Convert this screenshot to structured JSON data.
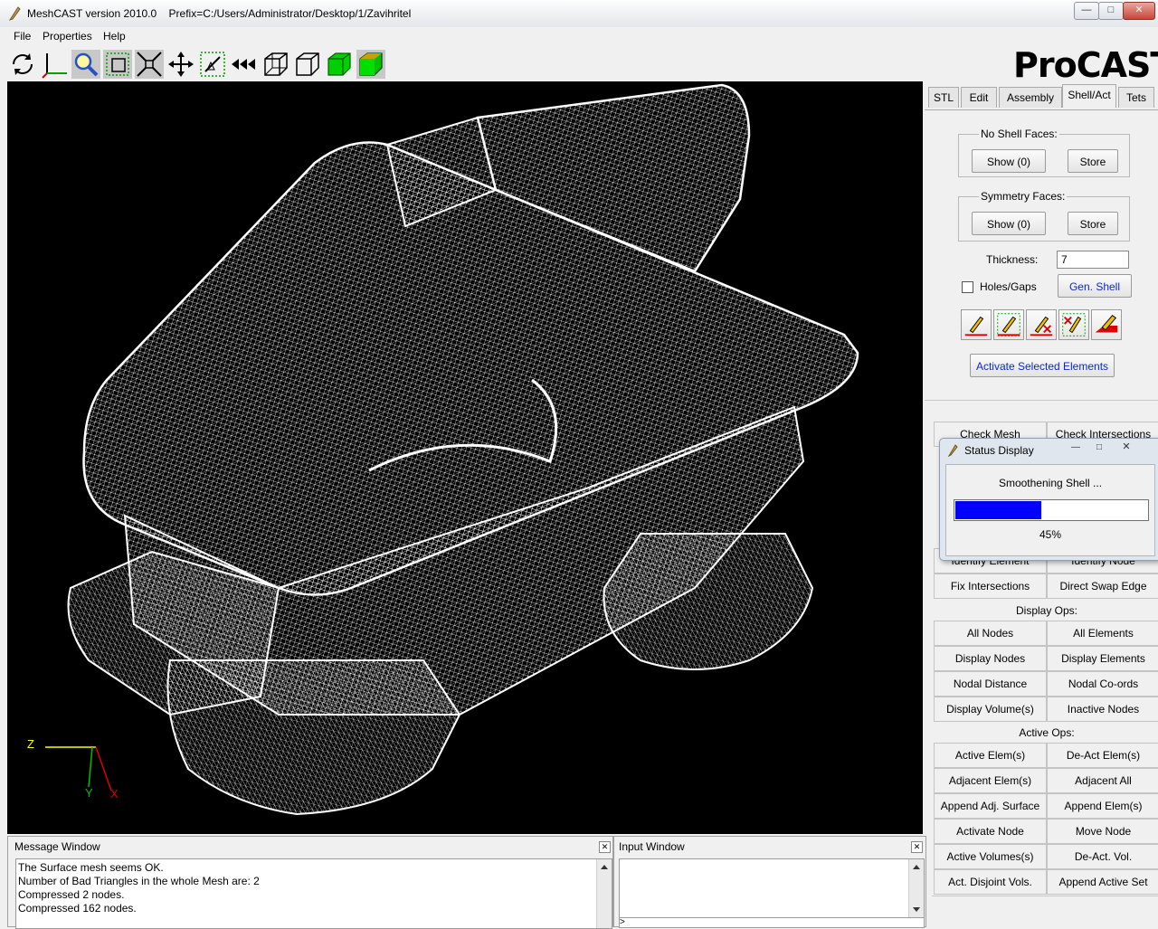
{
  "window": {
    "title": "MeshCAST version 2010.0    Prefix=C:/Users/Administrator/Desktop/1/Zavihritel",
    "min": "—",
    "max": "□",
    "close": "✕"
  },
  "menu": {
    "file": "File",
    "properties": "Properties",
    "help": "Help"
  },
  "toolbar": {
    "icons": [
      "rotate-icon",
      "axes-icon",
      "zoom-icon",
      "zoom-box-icon",
      "fit-icon",
      "pan-icon",
      "select-icon",
      "rewind-icon",
      "wire-box-icon",
      "hidden-box-icon",
      "solid-box-icon",
      "shaded-box-icon"
    ]
  },
  "brand": "ProCAST",
  "tabs": [
    "STL",
    "Edit",
    "Assembly",
    "Shell/Act",
    "Tets"
  ],
  "active_tab": "Shell/Act",
  "shell": {
    "no_shell_faces_label": "No Shell Faces:",
    "symmetry_faces_label": "Symmetry Faces:",
    "show_label": "Show (0)",
    "store_label": "Store",
    "thickness_label": "Thickness:",
    "thickness_value": "7",
    "holes_gaps_label": "Holes/Gaps",
    "gen_shell_label": "Gen. Shell",
    "activate_selected_label": "Activate Selected Elements"
  },
  "check_row": {
    "left": "Check Mesh",
    "right": "Check Intersections"
  },
  "identify_row": {
    "left": "Identify Element",
    "right": "Identify Node"
  },
  "fix_row": {
    "left": "Fix Intersections",
    "right": "Direct Swap Edge"
  },
  "display_ops": {
    "title": "Display Ops:",
    "rows": [
      [
        "All Nodes",
        "All Elements"
      ],
      [
        "Display Nodes",
        "Display Elements"
      ],
      [
        "Nodal Distance",
        "Nodal Co-ords"
      ],
      [
        "Display Volume(s)",
        "Inactive Nodes"
      ]
    ]
  },
  "active_ops": {
    "title": "Active Ops:",
    "rows": [
      [
        "Active Elem(s)",
        "De-Act Elem(s)"
      ],
      [
        "Adjacent Elem(s)",
        "Adjacent All"
      ],
      [
        "Append Adj. Surface",
        "Append Elem(s)"
      ],
      [
        "Activate Node",
        "Move Node"
      ],
      [
        "Active Volumes(s)",
        "De-Act. Vol."
      ],
      [
        "Act. Disjoint Vols.",
        "Append Active Set"
      ]
    ]
  },
  "status_display": {
    "title": "Status Display",
    "message": "Smoothening Shell ...",
    "progress": 0.45,
    "progress_label": "45%"
  },
  "axes": {
    "z": "Z",
    "y": "Y",
    "x": "X"
  },
  "message_window": {
    "title": "Message Window",
    "lines": [
      "The Surface mesh seems OK.",
      "Number of Bad Triangles in the whole Mesh are: 2",
      "Compressed 2 nodes.",
      "Compressed 162 nodes."
    ]
  },
  "input_window": {
    "title": "Input Window",
    "prompt": ">"
  },
  "colors": {
    "progress": "#0000ff",
    "link_text": "#0a28d8",
    "viewport_bg": "#000000",
    "mesh": "#ffffff"
  }
}
